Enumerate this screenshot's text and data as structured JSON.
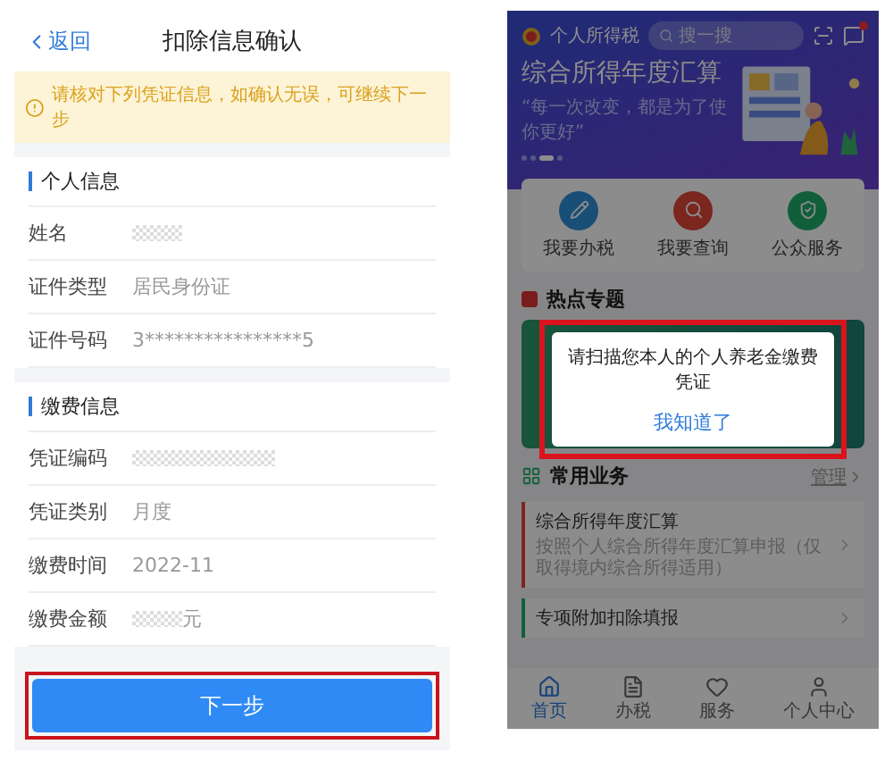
{
  "left": {
    "nav": {
      "back": "返回",
      "title": "扣除信息确认"
    },
    "notice": "请核对下列凭证信息，如确认无误，可继续下一步",
    "sections": [
      {
        "title": "个人信息",
        "rows": [
          {
            "label": "姓名",
            "kind": "redacted"
          },
          {
            "label": "证件类型",
            "kind": "text",
            "value": "居民身份证"
          },
          {
            "label": "证件号码",
            "kind": "text",
            "value": "3****************5"
          }
        ]
      },
      {
        "title": "缴费信息",
        "rows": [
          {
            "label": "凭证编码",
            "kind": "redacted_long"
          },
          {
            "label": "凭证类别",
            "kind": "text",
            "value": "月度"
          },
          {
            "label": "缴费时间",
            "kind": "text",
            "value": "2022-11"
          },
          {
            "label": "缴费金额",
            "kind": "redacted_suffix",
            "value": "元"
          }
        ]
      }
    ],
    "next_button": "下一步"
  },
  "right": {
    "app_title": "个人所得税",
    "search": {
      "placeholder": "搜一搜"
    },
    "banner": {
      "title": "综合所得年度汇算",
      "subtitle": "“每一次改变，都是为了使你更好”",
      "dots": [
        {
          "selected": false
        },
        {
          "selected": false
        },
        {
          "selected": true
        },
        {
          "selected": false
        }
      ]
    },
    "quick_actions": [
      {
        "label": "我要办税"
      },
      {
        "label": "我要查询"
      },
      {
        "label": "公众服务"
      }
    ],
    "hot_title": "热点专题",
    "common": {
      "title": "常用业务",
      "manage": "管理",
      "items": [
        {
          "title": "综合所得年度汇算",
          "subtitle": "按照个人综合所得年度汇算申报（仅取得境内综合所得适用）"
        },
        {
          "title": "专项附加扣除填报"
        }
      ]
    },
    "tabs": [
      {
        "label": "首页",
        "selected": true
      },
      {
        "label": "办税",
        "selected": false
      },
      {
        "label": "服务",
        "selected": false
      },
      {
        "label": "个人中心",
        "selected": false
      }
    ],
    "dialog": {
      "message": "请扫描您本人的个人养老金缴费凭证",
      "button": "我知道了"
    }
  }
}
